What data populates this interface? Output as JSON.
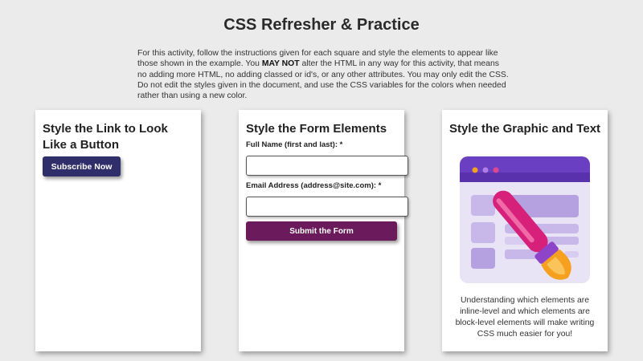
{
  "page": {
    "title": "CSS Refresher & Practice",
    "intro_before": "For this activity, follow the instructions given for each square and style the elements to appear like those shown in the example. You ",
    "intro_bold": "MAY NOT",
    "intro_after": " alter the HTML in any way for this activity, that means no adding more HTML, no adding classed or id's, or any other attributes. You may only edit the CSS. Do not edit the styles given in the document, and use the CSS variables for the colors when needed rather than using a new color."
  },
  "card_link": {
    "title": "Style the Link to Look Like a Button",
    "button_label": "Subscribe Now"
  },
  "card_form": {
    "title": "Style the Form Elements",
    "name_label": "Full Name (first and last): *",
    "email_label": "Email Address (address@site.com): *",
    "name_value": "",
    "email_value": "",
    "submit_label": "Submit the Form"
  },
  "card_graphic": {
    "title": "Style the Graphic and Text",
    "graphic_icon": "browser-paintbrush-icon",
    "caption": "Understanding which elements are inline-level and which elements are block-level elements will make writing CSS much easier for you!"
  },
  "colors": {
    "background": "#ebebeb",
    "link_button": "#2f2d6a",
    "submit_button": "#6b1a5b",
    "graphic_purple": "#6b3fc2",
    "brush_pink": "#d6207a",
    "brush_orange": "#f5a01f"
  }
}
